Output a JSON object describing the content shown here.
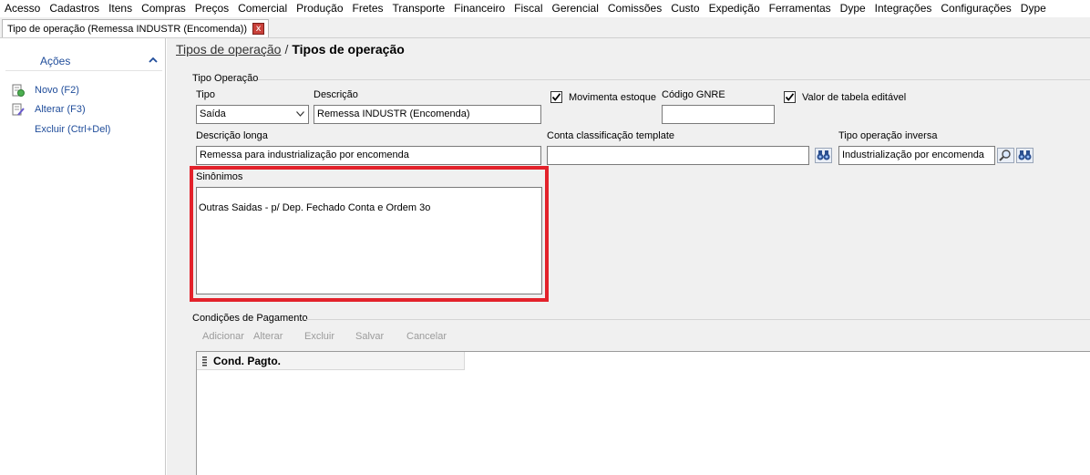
{
  "menu": [
    "Acesso",
    "Cadastros",
    "Itens",
    "Compras",
    "Preços",
    "Comercial",
    "Produção",
    "Fretes",
    "Transporte",
    "Financeiro",
    "Fiscal",
    "Gerencial",
    "Comissões",
    "Custo",
    "Expedição",
    "Ferramentas",
    "Dype",
    "Integrações",
    "Configurações",
    "Dype"
  ],
  "tab": {
    "label": "Tipo de operação (Remessa INDUSTR (Encomenda))",
    "close": "x"
  },
  "acoes": {
    "title": "Ações",
    "items": [
      {
        "label": "Novo (F2)",
        "icon": "new-document-icon"
      },
      {
        "label": "Alterar (F3)",
        "icon": "edit-document-icon"
      },
      {
        "label": "Excluir (Ctrl+Del)",
        "icon": ""
      }
    ]
  },
  "breadcrumb": {
    "link": "Tipos de operação",
    "sep": "/",
    "current": "Tipos de operação"
  },
  "tipo_operacao": {
    "group_label": "Tipo Operação",
    "tipo": {
      "label": "Tipo",
      "value": "Saída"
    },
    "descricao": {
      "label": "Descrição",
      "value": "Remessa INDUSTR (Encomenda)"
    },
    "movimenta_estoque": {
      "label": "Movimenta estoque",
      "checked": true
    },
    "codigo_gnre": {
      "label": "Código GNRE",
      "value": ""
    },
    "valor_tabela_editavel": {
      "label": "Valor de tabela editável",
      "checked": true
    },
    "descricao_longa": {
      "label": "Descrição longa",
      "value": "Remessa para industrialização por encomenda"
    },
    "conta_classificacao": {
      "label": "Conta classificação template",
      "value": ""
    },
    "tipo_operacao_inversa": {
      "label": "Tipo operação inversa",
      "value": "Industrialização por encomenda"
    },
    "sinonimos": {
      "label": "Sinônimos",
      "value": "Outras Saidas - p/ Dep. Fechado Conta e Ordem 3o"
    }
  },
  "condicoes": {
    "group_label": "Condições de Pagamento",
    "toolbar": [
      "Adicionar",
      "Alterar",
      "Excluir",
      "Salvar",
      "Cancelar"
    ],
    "columns": [
      "Cond. Pagto."
    ],
    "rows": []
  },
  "colors": {
    "highlight": "#e3222b",
    "link": "#1f4c9a",
    "close_button": "#c9413a"
  }
}
